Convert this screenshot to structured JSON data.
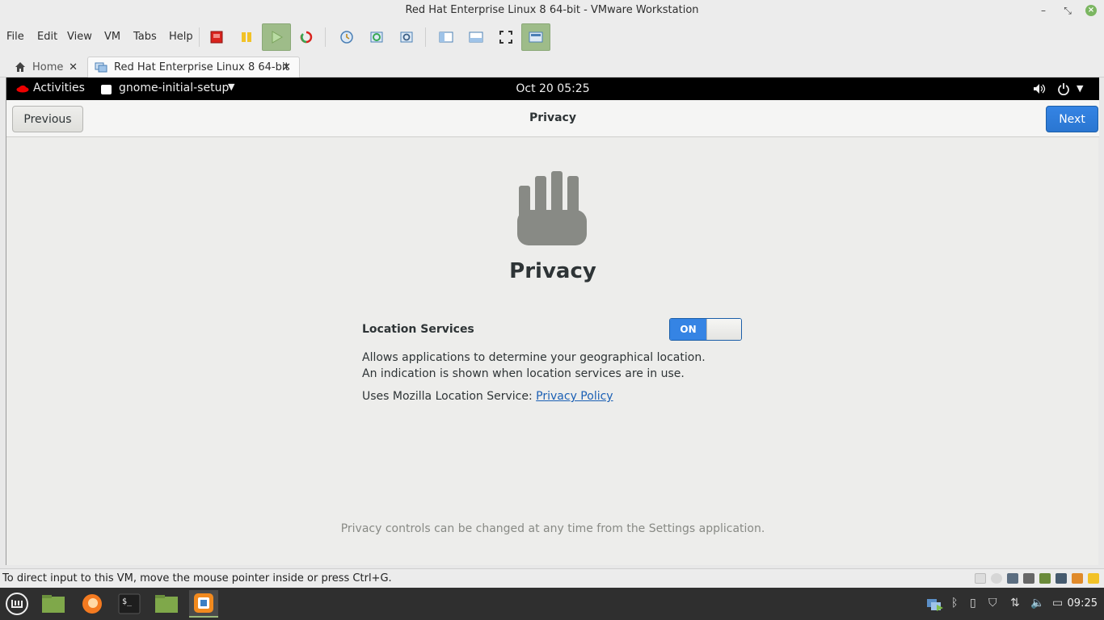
{
  "window": {
    "title": "Red Hat Enterprise Linux 8 64-bit - VMware Workstation"
  },
  "menu": [
    "File",
    "Edit",
    "View",
    "VM",
    "Tabs",
    "Help"
  ],
  "tabs": [
    {
      "label": "Home"
    },
    {
      "label": "Red Hat Enterprise Linux 8 64-bit"
    }
  ],
  "gnome": {
    "activities": "Activities",
    "app_menu": "gnome-initial-setup",
    "clock": "Oct 20  05:25"
  },
  "setup": {
    "previous_label": "Previous",
    "header_title": "Privacy",
    "next_label": "Next",
    "page_title": "Privacy",
    "location_label": "Location Services",
    "toggle_state": "ON",
    "description": "Allows applications to determine your geographical location. An indication is shown when location services are in use.",
    "uses_prefix": "Uses Mozilla Location Service:",
    "policy_link": "Privacy Policy",
    "footer_note": "Privacy controls can be changed at any time from the Settings application."
  },
  "statusbar": {
    "message": "To direct input to this VM, move the mouse pointer inside or press Ctrl+G."
  },
  "taskbar": {
    "time": "09:25"
  },
  "colors": {
    "accent": "#3584e4",
    "link": "#1a5fb4",
    "vmware_active": "#9ebc89"
  }
}
